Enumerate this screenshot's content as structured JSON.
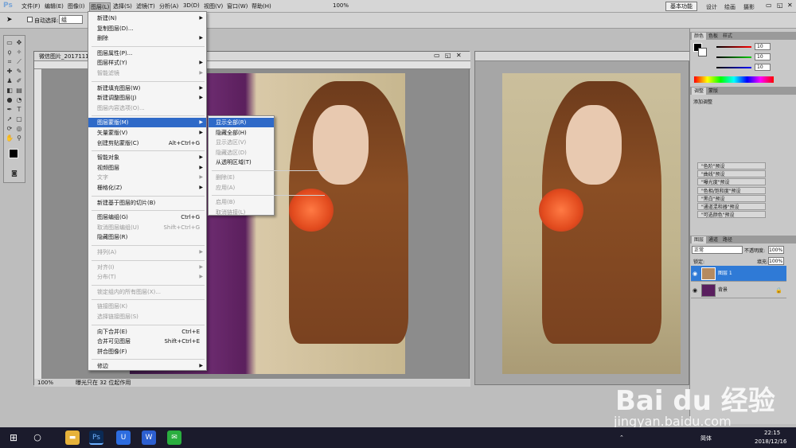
{
  "app": {
    "logo": "Ps"
  },
  "menubar": [
    "文件(F)",
    "编辑(E)",
    "图像(I)",
    "图层(L)",
    "选择(S)",
    "滤镜(T)",
    "分析(A)",
    "3D(D)",
    "视图(V)",
    "窗口(W)",
    "帮助(H)"
  ],
  "zoom": "100%",
  "workspace": {
    "active": "基本功能",
    "others": [
      "设计",
      "绘画",
      "摄影"
    ]
  },
  "options": {
    "auto_select_label": "自动选择:",
    "auto_select_value": "组"
  },
  "document1": {
    "title": "微信图片_2017111",
    "zoom": "100%",
    "status": "曝光只在 32 位起作用"
  },
  "layer_menu": {
    "items": [
      {
        "label": "新建(N)",
        "arrow": true,
        "enabled": true
      },
      {
        "label": "复制图层(D)...",
        "enabled": true
      },
      {
        "label": "删除",
        "arrow": true,
        "enabled": true
      },
      {
        "sep": true
      },
      {
        "label": "图层属性(P)...",
        "enabled": true
      },
      {
        "label": "图层样式(Y)",
        "arrow": true,
        "enabled": true
      },
      {
        "label": "智能滤镜",
        "arrow": true,
        "enabled": false
      },
      {
        "sep": true
      },
      {
        "label": "新建填充图层(W)",
        "arrow": true,
        "enabled": true
      },
      {
        "label": "新建调整图层(J)",
        "arrow": true,
        "enabled": true
      },
      {
        "label": "图层内容选项(O)...",
        "enabled": false
      },
      {
        "sep": true
      },
      {
        "label": "图层蒙版(M)",
        "arrow": true,
        "enabled": true,
        "highlight": true
      },
      {
        "label": "矢量蒙版(V)",
        "arrow": true,
        "enabled": true
      },
      {
        "label": "创建剪贴蒙版(C)",
        "shortcut": "Alt+Ctrl+G",
        "enabled": true
      },
      {
        "sep": true
      },
      {
        "label": "智能对象",
        "arrow": true,
        "enabled": true
      },
      {
        "label": "视频图层",
        "arrow": true,
        "enabled": true
      },
      {
        "label": "文字",
        "arrow": true,
        "enabled": false
      },
      {
        "label": "栅格化(Z)",
        "arrow": true,
        "enabled": true
      },
      {
        "sep": true
      },
      {
        "label": "新建基于图层的切片(B)",
        "enabled": true
      },
      {
        "sep": true
      },
      {
        "label": "图层编组(G)",
        "shortcut": "Ctrl+G",
        "enabled": true
      },
      {
        "label": "取消图层编组(U)",
        "shortcut": "Shift+Ctrl+G",
        "enabled": false
      },
      {
        "label": "隐藏图层(R)",
        "enabled": true
      },
      {
        "sep": true
      },
      {
        "label": "排列(A)",
        "arrow": true,
        "enabled": false
      },
      {
        "sep": true
      },
      {
        "label": "对齐(I)",
        "arrow": true,
        "enabled": false
      },
      {
        "label": "分布(T)",
        "arrow": true,
        "enabled": false
      },
      {
        "sep": true
      },
      {
        "label": "锁定组内的所有图层(X)...",
        "enabled": false
      },
      {
        "sep": true
      },
      {
        "label": "链接图层(K)",
        "enabled": false
      },
      {
        "label": "选择链接图层(S)",
        "enabled": false
      },
      {
        "sep": true
      },
      {
        "label": "向下合并(E)",
        "shortcut": "Ctrl+E",
        "enabled": true
      },
      {
        "label": "合并可见图层",
        "shortcut": "Shift+Ctrl+E",
        "enabled": true
      },
      {
        "label": "拼合图像(F)",
        "enabled": true
      },
      {
        "sep": true
      },
      {
        "label": "修边",
        "arrow": true,
        "enabled": true
      }
    ]
  },
  "mask_submenu": {
    "items": [
      {
        "label": "显示全部(R)",
        "enabled": true,
        "highlight": true
      },
      {
        "label": "隐藏全部(H)",
        "enabled": true
      },
      {
        "label": "显示选区(V)",
        "enabled": false
      },
      {
        "label": "隐藏选区(D)",
        "enabled": false
      },
      {
        "label": "从透明区域(T)",
        "enabled": true
      },
      {
        "sep": true
      },
      {
        "label": "删除(E)",
        "enabled": false
      },
      {
        "label": "应用(A)",
        "enabled": false
      },
      {
        "sep": true
      },
      {
        "label": "启用(B)",
        "enabled": false
      },
      {
        "label": "取消链接(L)",
        "enabled": false
      }
    ]
  },
  "color_panel": {
    "tabs": [
      "颜色",
      "色板",
      "样式"
    ],
    "r": "10",
    "g": "10",
    "b": "10"
  },
  "adjust_panel": {
    "tabs": [
      "调整",
      "蒙版"
    ],
    "title": "添加调整",
    "presets": [
      "\"色阶\"预设",
      "\"曲线\"预设",
      "\"曝光度\"预设",
      "\"色相/饱和度\"预设",
      "\"黑白\"预设",
      "\"通道混和器\"预设",
      "\"可选颜色\"预设"
    ]
  },
  "layers_panel": {
    "tabs": [
      "图层",
      "通道",
      "路径"
    ],
    "blend": "正常",
    "opacity_label": "不透明度:",
    "opacity": "100%",
    "lock_label": "锁定:",
    "fill_label": "填充:",
    "fill": "100%",
    "layers": [
      {
        "name": "图层 1",
        "selected": true
      },
      {
        "name": "背景",
        "selected": false
      }
    ]
  },
  "taskbar": {
    "time": "22:15",
    "date": "2018/12/16",
    "ime": "简体"
  },
  "watermark": {
    "brand": "Bai du 经验",
    "url": "jingyan.baidu.com"
  }
}
